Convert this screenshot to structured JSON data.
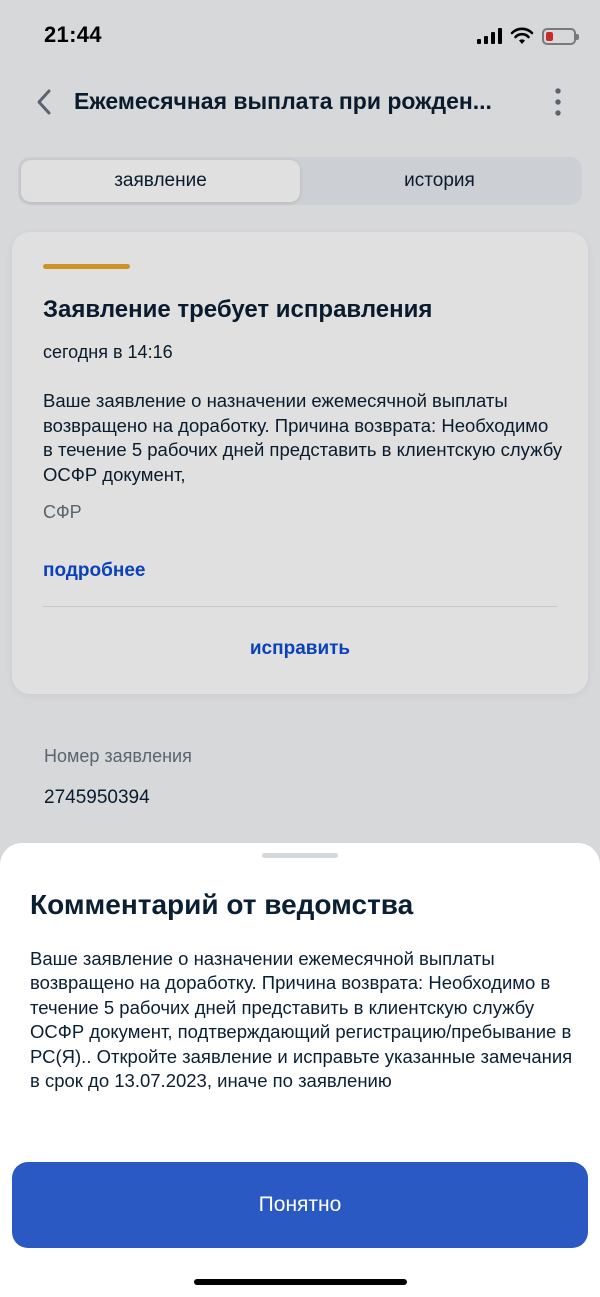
{
  "status_bar": {
    "time": "21:44"
  },
  "header": {
    "title": "Ежемесячная выплата при рожден..."
  },
  "tabs": [
    {
      "label": "заявление",
      "active": true
    },
    {
      "label": "история",
      "active": false
    }
  ],
  "card": {
    "title": "Заявление требует исправления",
    "date": "сегодня в 14:16",
    "text": "Ваше заявление о назначении ежемесячной выплаты возвращено на доработку. Причина возврата: Необходимо в течение 5 рабочих дней представить в клиентскую службу ОСФР документ,",
    "org": "СФР",
    "more_link": "подробнее",
    "fix_button": "исправить",
    "status_color": "#e8a82e"
  },
  "application_number": {
    "label": "Номер заявления",
    "value": "2745950394"
  },
  "sheet": {
    "title": "Комментарий от ведомства",
    "text": "Ваше заявление о назначении ежемесячной выплаты возвращено на доработку. Причина возврата: Необходимо в течение 5 рабочих дней представить в клиентскую службу ОСФР документ, подтверждающий регистрацию/пребывание в РС(Я).. Откройте заявление и исправьте указанные замечания в срок до 13.07.2023, иначе по заявлению",
    "ok_button": "Понятно",
    "accent_color": "#2a59c4"
  }
}
